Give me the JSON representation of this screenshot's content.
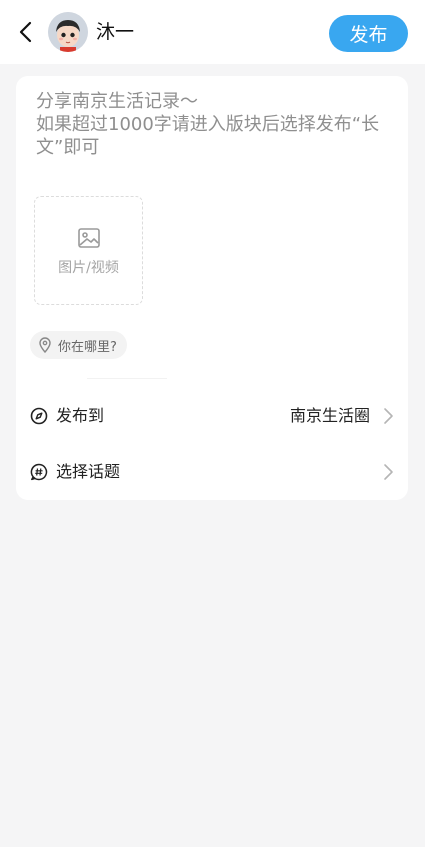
{
  "header": {
    "username": "沐一",
    "publish_label": "发布"
  },
  "editor": {
    "placeholder": "分享南京生活记录～\n如果超过1000字请进入版块后选择发布“长文”即可"
  },
  "upload": {
    "label": "图片/视频"
  },
  "location": {
    "placeholder": "你在哪里?"
  },
  "rows": [
    {
      "icon": "compass-icon",
      "label": "发布到",
      "value": "南京生活圈"
    },
    {
      "icon": "topic-hash-icon",
      "label": "选择话题",
      "value": ""
    }
  ],
  "colors": {
    "accent": "#39a7f0",
    "background": "#f5f5f6",
    "card": "#ffffff"
  }
}
